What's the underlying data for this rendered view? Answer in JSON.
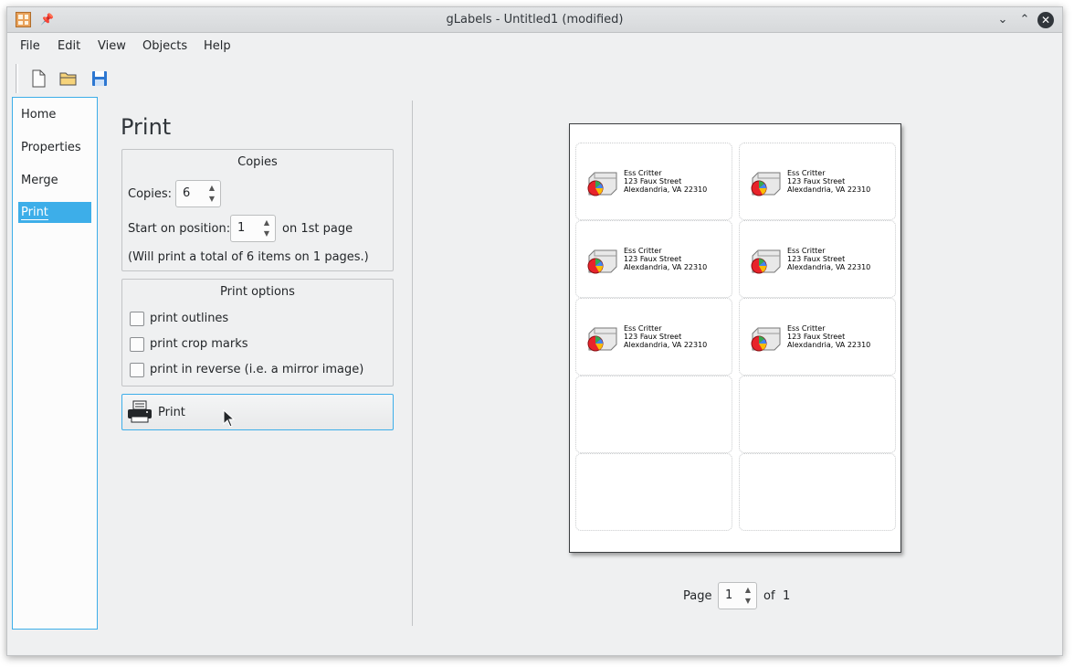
{
  "window": {
    "title": "gLabels - Untitled1 (modified)"
  },
  "menu": [
    "File",
    "Edit",
    "View",
    "Objects",
    "Help"
  ],
  "toolbar": {
    "icons": [
      "new-document-icon",
      "open-folder-icon",
      "save-icon"
    ]
  },
  "nav": {
    "items": [
      "Home",
      "Properties",
      "Merge",
      "Print"
    ],
    "selected": "Print"
  },
  "print": {
    "heading": "Print",
    "copies_group": {
      "title": "Copies",
      "copies_label": "Copies:",
      "copies_value": "6",
      "start_label": "Start on position:",
      "start_value": "1",
      "start_suffix": "on 1st page",
      "summary": "(Will print a total of 6 items on 1 pages.)"
    },
    "options_group": {
      "title": "Print options",
      "options": [
        {
          "label": "print outlines",
          "checked": false
        },
        {
          "label": "print crop marks",
          "checked": false
        },
        {
          "label": "print in reverse (i.e. a mirror image)",
          "checked": false
        }
      ]
    },
    "print_button": "Print"
  },
  "preview": {
    "label_text": [
      "Ess Critter",
      "123 Faux Street",
      "Alexdandria, VA 22310"
    ],
    "labels_filled": 6,
    "labels_total": 10,
    "page_label": "Page",
    "page_value": "1",
    "of_label": "of",
    "total_pages": "1"
  },
  "colors": {
    "accent": "#3daee9",
    "window_bg": "#eff0f1"
  }
}
